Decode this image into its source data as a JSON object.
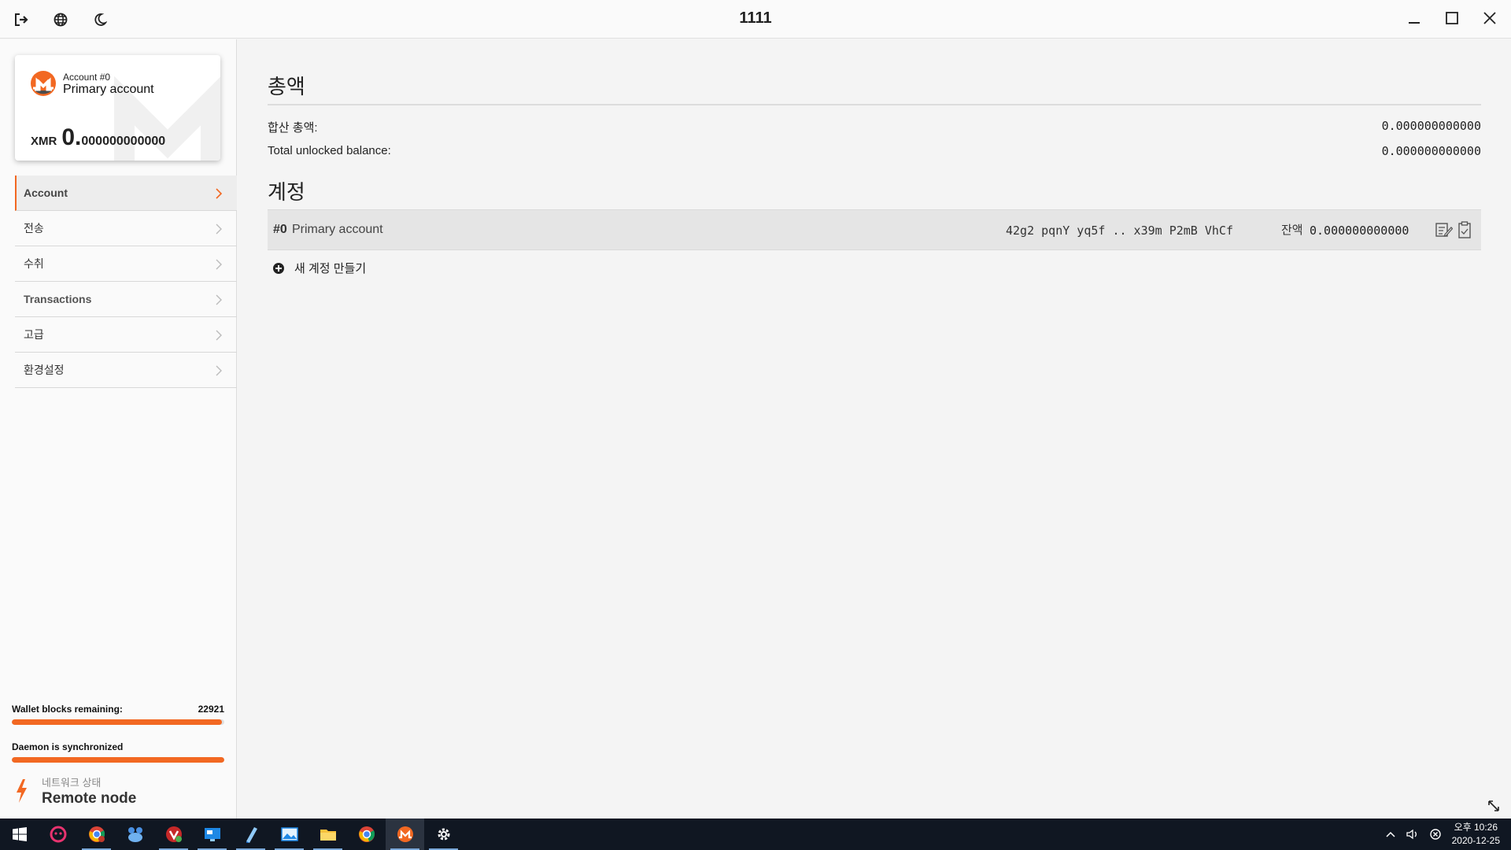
{
  "window": {
    "title": "1111"
  },
  "card": {
    "account_number": "Account #0",
    "account_name": "Primary account",
    "currency": "XMR",
    "balance_int": "0.",
    "balance_dec": "000000000000"
  },
  "menu": [
    {
      "label": "Account",
      "active": true
    },
    {
      "label": "전송",
      "active": false
    },
    {
      "label": "수취",
      "active": false
    },
    {
      "label": "Transactions",
      "active": false
    },
    {
      "label": "고급",
      "active": false
    },
    {
      "label": "환경설정",
      "active": false
    }
  ],
  "sync": {
    "wallet_label": "Wallet blocks remaining:",
    "wallet_value": "22921",
    "wallet_progress": 0.99,
    "daemon_label": "Daemon is synchronized",
    "daemon_progress": 1.0
  },
  "network": {
    "label": "네트워크 상태",
    "value": "Remote node"
  },
  "main": {
    "total_heading": "총액",
    "combined_label": "합산 총액:",
    "combined_value": "0.000000000000",
    "unlocked_label": "Total unlocked balance:",
    "unlocked_value": "0.000000000000",
    "accounts_heading": "계정",
    "accounts": [
      {
        "index": "#0",
        "name": "Primary account",
        "address": "42g2 pqnY yq5f .. x39m P2mB VhCf",
        "balance_label": "잔액",
        "balance_value": "0.000000000000"
      }
    ],
    "create_label": "새 계정 만들기"
  },
  "taskbar": {
    "time": "오후 10:26",
    "date": "2020-12-25"
  },
  "colors": {
    "accent": "#f26822",
    "taskbar": "#101722"
  }
}
